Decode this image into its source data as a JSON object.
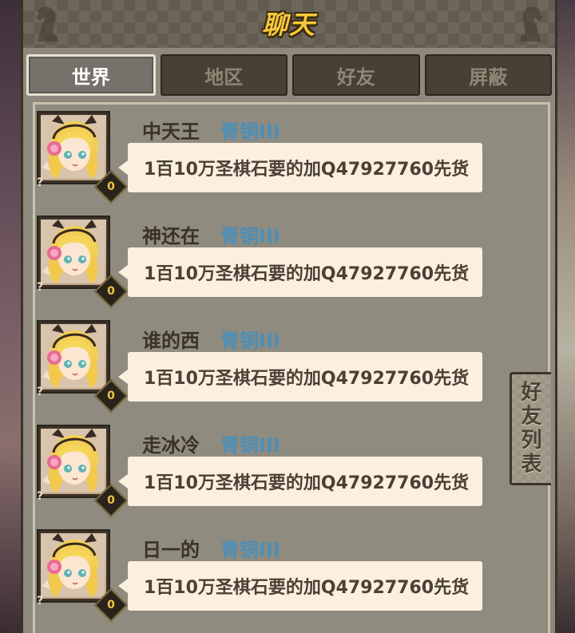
{
  "header": {
    "title": "聊天"
  },
  "tabs": [
    {
      "label": "世界",
      "active": true
    },
    {
      "label": "地区",
      "active": false
    },
    {
      "label": "好友",
      "active": false
    },
    {
      "label": "屏蔽",
      "active": false
    }
  ],
  "messages": [
    {
      "name": "中天王",
      "rank": "青铜III",
      "level": "0",
      "text": "1百10万圣棋石要的加Q47927760先货"
    },
    {
      "name": "神还在",
      "rank": "青铜III",
      "level": "0",
      "text": "1百10万圣棋石要的加Q47927760先货"
    },
    {
      "name": "谁的西",
      "rank": "青铜III",
      "level": "0",
      "text": "1百10万圣棋石要的加Q47927760先货"
    },
    {
      "name": "走冰冷",
      "rank": "青铜III",
      "level": "0",
      "text": "1百10万圣棋石要的加Q47927760先货"
    },
    {
      "name": "日一的",
      "rank": "青铜III",
      "level": "0",
      "text": "1百10万圣棋石要的加Q47927760先货"
    }
  ],
  "avatar_qmark": "?",
  "friends_list_button": {
    "label_chars": [
      "好",
      "友",
      "列",
      "表"
    ]
  },
  "colors": {
    "title": "#f6c93a",
    "rank": "#4c8fb8",
    "bubble": "#fbefde",
    "level_badge": "#f1c63d"
  },
  "icons": {
    "header_decor": "chess-knight-icon",
    "avatar": "anime-girl-headphones-avatar"
  }
}
